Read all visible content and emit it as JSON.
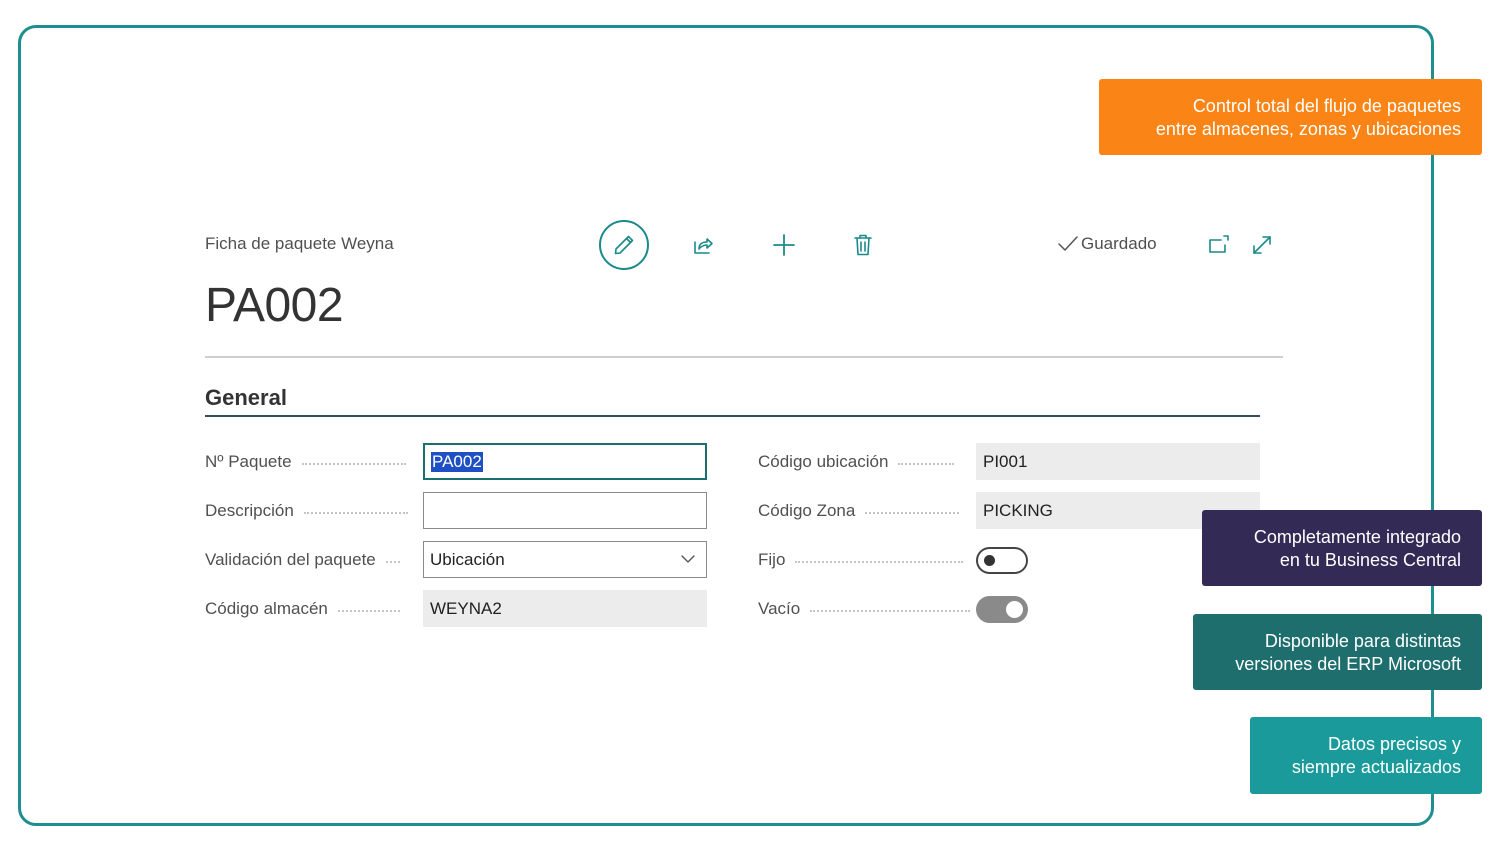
{
  "page": {
    "caption": "Ficha de paquete Weyna",
    "record_title": "PA002",
    "status": "Guardado"
  },
  "toolbar": {
    "icons": [
      "edit-icon",
      "share-icon",
      "add-icon",
      "delete-icon",
      "open-in-new-window-icon",
      "expand-icon"
    ]
  },
  "general": {
    "title": "General",
    "left_fields": [
      {
        "label": "Nº Paquete",
        "value": "PA002",
        "type": "text-selected"
      },
      {
        "label": "Descripción",
        "value": "",
        "type": "text"
      },
      {
        "label": "Validación del paquete",
        "value": "Ubicación",
        "type": "select"
      },
      {
        "label": "Código almacén",
        "value": "WEYNA2",
        "type": "readonly"
      }
    ],
    "right_fields": [
      {
        "label": "Código ubicación",
        "value": "PI001",
        "type": "readonly"
      },
      {
        "label": "Código Zona",
        "value": "PICKING",
        "type": "readonly"
      },
      {
        "label": "Fijo",
        "value": "off",
        "type": "toggle"
      },
      {
        "label": "Vacío",
        "value": "on",
        "type": "toggle"
      }
    ]
  },
  "callouts": [
    {
      "line1": "Control total del flujo de paquetes",
      "line2": "entre almacenes, zonas y ubicaciones",
      "color": "#fa8516"
    },
    {
      "line1": "Completamente integrado",
      "line2": "en tu Business Central",
      "color": "#332b55"
    },
    {
      "line1": "Disponible para distintas",
      "line2": "versiones del ERP Microsoft",
      "color": "#1f6e6e"
    },
    {
      "line1": "Datos precisos y",
      "line2": "siempre actualizados",
      "color": "#1a9a9a"
    }
  ],
  "colors": {
    "frame_border": "#1e8e8e",
    "accent": "#1a8a8a",
    "selection": "#1f4fc4"
  }
}
